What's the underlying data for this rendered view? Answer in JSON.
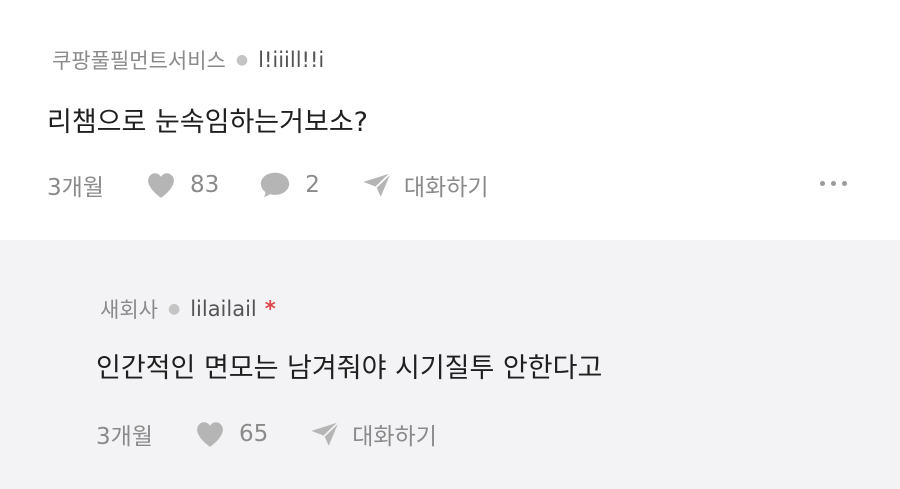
{
  "comments": [
    {
      "company": "쿠팡풀필먼트서비스",
      "author": "l!iiill!!i",
      "text": "리챔으로 눈속임하는거보소?",
      "time": "3개월",
      "likes": "83",
      "replies": "2",
      "reply_label": "대화하기"
    },
    {
      "company": "새회사",
      "author": "lilailail",
      "badge": "*",
      "text": "인간적인 면모는 남겨줘야 시기질투 안한다고",
      "time": "3개월",
      "likes": "65",
      "reply_label": "대화하기"
    }
  ],
  "colors": {
    "reply_background": "#f3f3f5",
    "badge": "#e0454a",
    "muted_text": "#8a8a8a",
    "icon": "#b5b5b5"
  },
  "icons": [
    "heart-icon",
    "speech-bubble-icon",
    "paper-plane-icon",
    "more-icon"
  ]
}
